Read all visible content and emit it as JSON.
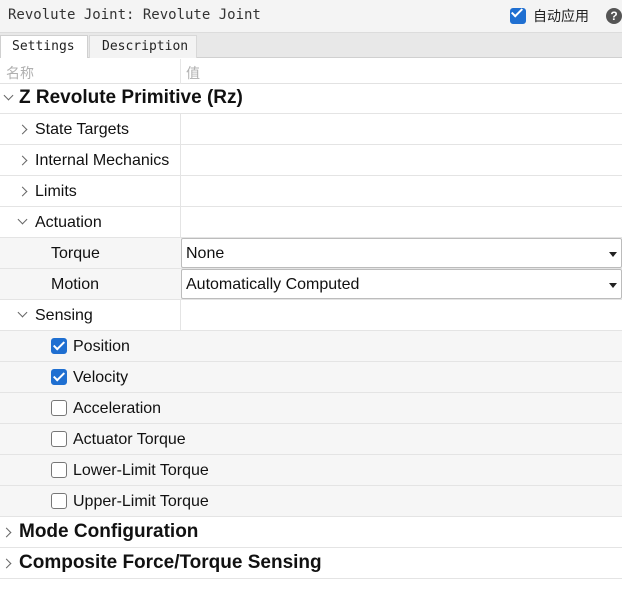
{
  "window": {
    "title": "Revolute Joint: Revolute Joint"
  },
  "auto_apply": {
    "label": "自动应用",
    "checked": true
  },
  "help_icon": "?",
  "tabs": [
    {
      "label": "Settings",
      "active": true
    },
    {
      "label": "Description",
      "active": false
    }
  ],
  "columns": {
    "name": "名称",
    "value": "值"
  },
  "tree": {
    "primitive_section": "Z Revolute Primitive (Rz)",
    "state_targets": "State Targets",
    "internal_mechanics": "Internal Mechanics",
    "limits": "Limits",
    "actuation": {
      "label": "Actuation",
      "torque_label": "Torque",
      "torque_value": "None",
      "motion_label": "Motion",
      "motion_value": "Automatically Computed"
    },
    "sensing": {
      "label": "Sensing",
      "items": [
        {
          "label": "Position",
          "checked": true
        },
        {
          "label": "Velocity",
          "checked": true
        },
        {
          "label": "Acceleration",
          "checked": false
        },
        {
          "label": "Actuator Torque",
          "checked": false
        },
        {
          "label": "Lower-Limit Torque",
          "checked": false
        },
        {
          "label": "Upper-Limit Torque",
          "checked": false
        }
      ]
    },
    "mode_configuration": "Mode Configuration",
    "composite_sensing": "Composite Force/Torque Sensing"
  },
  "colors": {
    "accent": "#1f6fd1"
  }
}
